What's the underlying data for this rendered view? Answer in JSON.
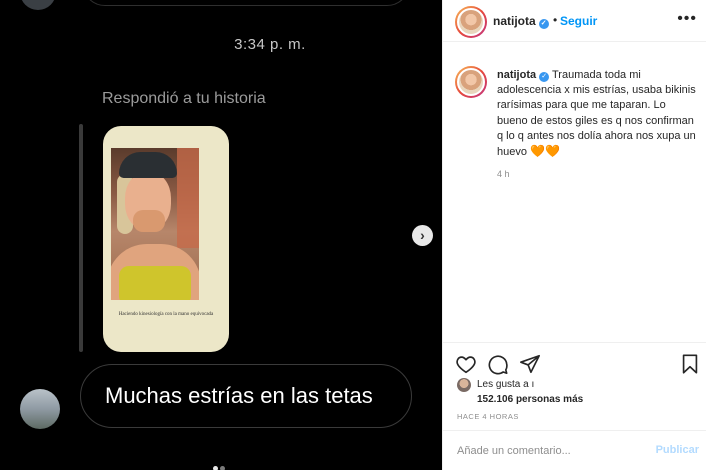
{
  "dm": {
    "time": "3:34 p. m.",
    "replied_label": "Respondió a tu historia",
    "story_caption": "Haciendo kinesiología con la mano equivocada",
    "message": "Muchas estrías en las tetas"
  },
  "carousel": {
    "dots": 2,
    "active_dot": 1
  },
  "post": {
    "username": "natijota",
    "follow_label": "Seguir",
    "caption": "Traumada toda mi adolescencia x mis estrías, usaba bikinis rarísimas para que me taparan. Lo bueno de estos giles es q nos confirman q lo q antes nos dolía ahora nos xupa un huevo",
    "caption_emoji": "🧡🧡",
    "posted_ago": "4 h",
    "likes_label": "Les gusta a ı",
    "likes_count": "152.106",
    "likes_more": "personas más",
    "time_ago": "HACE 4 HORAS",
    "comment_placeholder": "Añade un comentario...",
    "publish_label": "Publicar"
  },
  "icons": {
    "verified": "verified-badge-icon",
    "more": "more-options-icon",
    "like": "heart-icon",
    "comment": "comment-icon",
    "share": "share-icon",
    "save": "bookmark-icon",
    "next": "chevron-right-icon"
  },
  "colors": {
    "accent": "#0095f6",
    "verified": "#3897f0",
    "publish_disabled": "#b3dbff",
    "dm_background": "#000000"
  }
}
